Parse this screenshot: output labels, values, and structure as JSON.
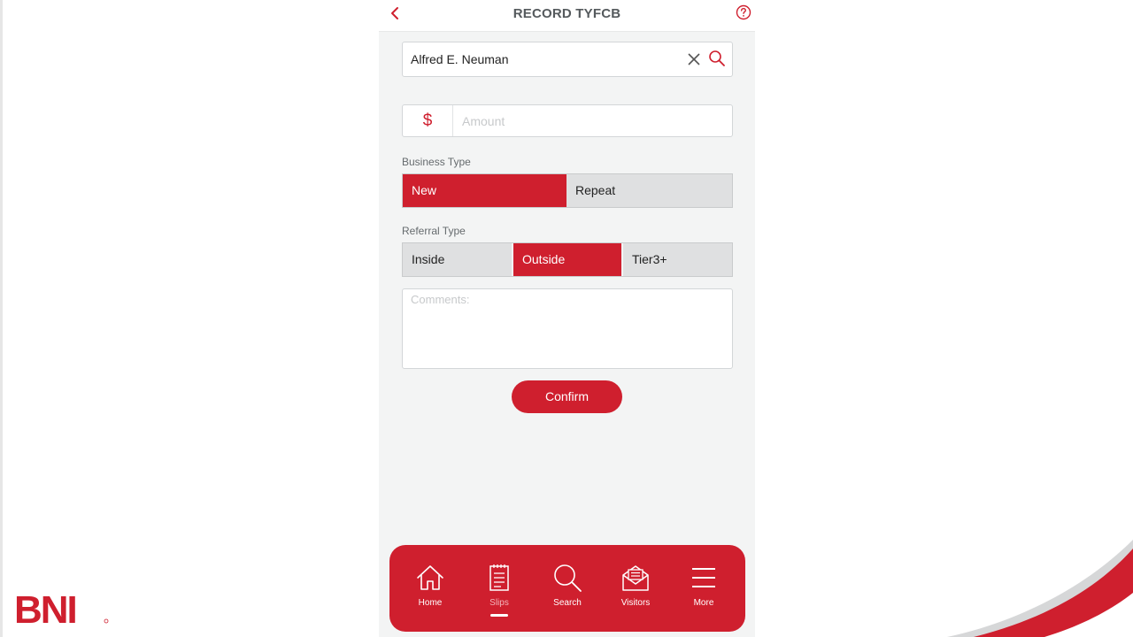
{
  "header": {
    "title": "RECORD TYFCB"
  },
  "form": {
    "member_value": "Alfred E. Neuman",
    "currency_symbol": "$",
    "amount_placeholder": "Amount",
    "business_type_label": "Business Type",
    "business_options": [
      "New",
      "Repeat"
    ],
    "business_selected": "New",
    "referral_type_label": "Referral Type",
    "referral_options": [
      "Inside",
      "Outside",
      "Tier3+"
    ],
    "referral_selected": "Outside",
    "comments_placeholder": "Comments:",
    "confirm_label": "Confirm"
  },
  "tabbar": {
    "items": [
      {
        "label": "Home",
        "icon": "home-icon"
      },
      {
        "label": "Slips",
        "icon": "slips-icon",
        "active": true
      },
      {
        "label": "Search",
        "icon": "search-icon"
      },
      {
        "label": "Visitors",
        "icon": "visitors-icon"
      },
      {
        "label": "More",
        "icon": "menu-icon"
      }
    ]
  },
  "branding": {
    "logo_text": "BNI"
  },
  "colors": {
    "accent": "#cf1f2e",
    "segment_inactive": "#dfe0e1",
    "background": "#f3f4f4"
  }
}
